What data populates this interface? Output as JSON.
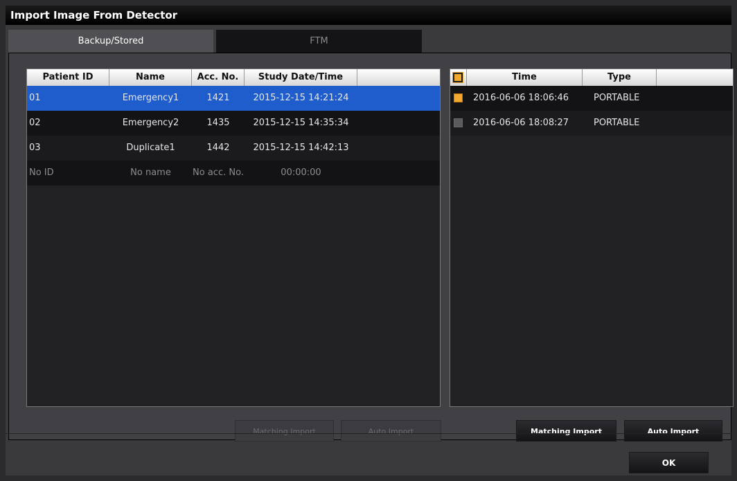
{
  "window": {
    "title": "Import Image From Detector"
  },
  "tabs": [
    {
      "label": "Backup/Stored",
      "active": true
    },
    {
      "label": "FTM",
      "active": false
    }
  ],
  "patients": {
    "columns": [
      "Patient ID",
      "Name",
      "Acc. No.",
      "Study Date/Time"
    ],
    "rows": [
      {
        "id": "01",
        "name": "Emergency1",
        "acc": "1421",
        "datetime": "2015-12-15 14:21:24",
        "selected": true
      },
      {
        "id": "02",
        "name": "Emergency2",
        "acc": "1435",
        "datetime": "2015-12-15 14:35:34",
        "selected": false
      },
      {
        "id": "03",
        "name": "Duplicate1",
        "acc": "1442",
        "datetime": "2015-12-15 14:42:13",
        "selected": false
      },
      {
        "id": "No ID",
        "name": "No name",
        "acc": "No acc. No.",
        "datetime": "00:00:00",
        "selected": false,
        "placeholder": true
      }
    ]
  },
  "images": {
    "columns": [
      "Time",
      "Type"
    ],
    "header_checkbox_checked": true,
    "rows": [
      {
        "time": "2016-06-06 18:06:46",
        "type": "PORTABLE",
        "checked": true
      },
      {
        "time": "2016-06-06 18:08:27",
        "type": "PORTABLE",
        "checked": false
      }
    ]
  },
  "buttons": {
    "left_matching_import": "Matching Import",
    "left_auto_import": "Auto Import",
    "right_matching_import": "Matching Import",
    "right_auto_import": "Auto Import",
    "ok": "OK"
  },
  "colors": {
    "selection": "#1f5ccc",
    "checkbox_accent": "#f0a830",
    "window_bg": "#3a3a3d"
  }
}
